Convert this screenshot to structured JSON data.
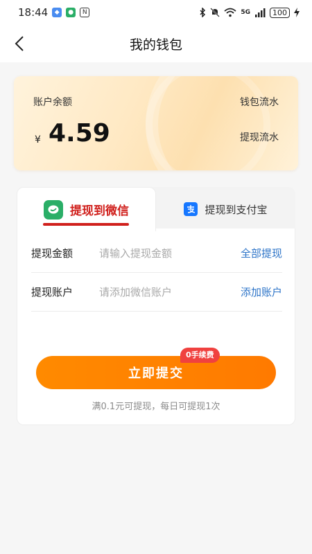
{
  "status_bar": {
    "time": "18:44",
    "network": "5G",
    "battery": "100"
  },
  "header": {
    "title": "我的钱包"
  },
  "balance_card": {
    "label": "账户余额",
    "currency": "¥",
    "amount": "4.59",
    "wallet_flow": "钱包流水",
    "withdraw_flow": "提现流水"
  },
  "tabs": [
    {
      "label": "提现到微信",
      "active": true,
      "icon": "wechat-icon"
    },
    {
      "label": "提现到支付宝",
      "active": false,
      "icon": "alipay-icon"
    }
  ],
  "form": {
    "amount_label": "提现金额",
    "amount_placeholder": "请输入提现金额",
    "amount_action": "全部提现",
    "account_label": "提现账户",
    "account_placeholder": "请添加微信账户",
    "account_action": "添加账户"
  },
  "submit": {
    "label": "立即提交",
    "badge": "0手续费"
  },
  "note": "满0.1元可提现，每日可提现1次",
  "colors": {
    "accent_orange": "#ff8a00",
    "active_tab_red": "#d0201c",
    "link_blue": "#2d74c8",
    "wechat_green": "#2aae67",
    "alipay_blue": "#1677ff"
  }
}
